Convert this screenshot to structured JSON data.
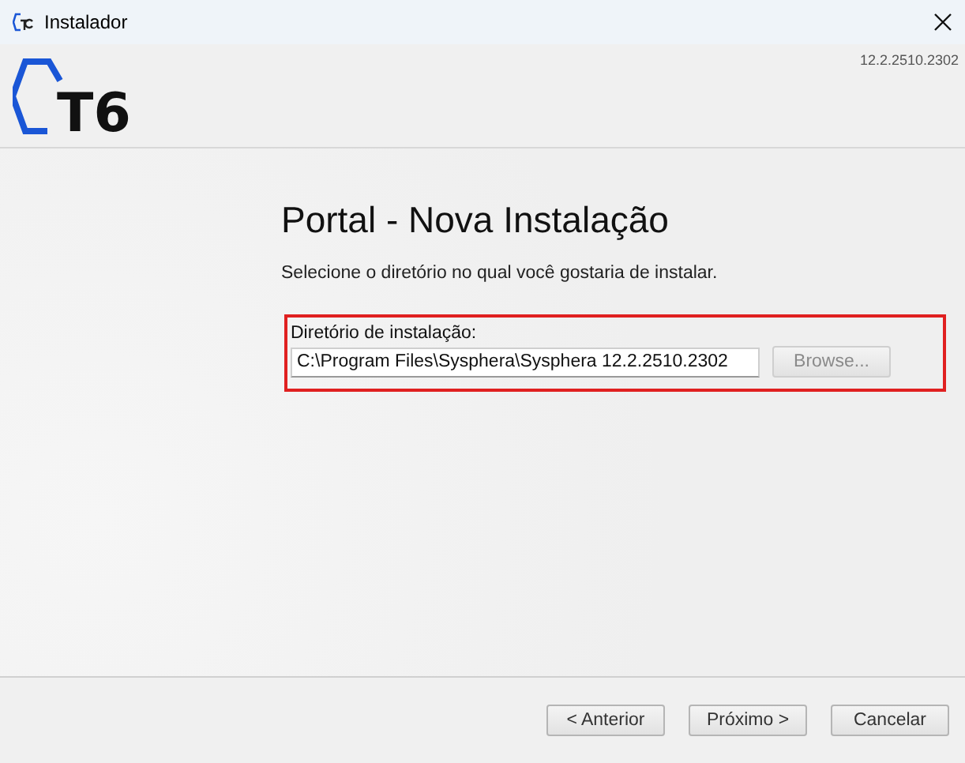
{
  "window": {
    "title": "Instalador"
  },
  "header": {
    "logo": "T6",
    "version": "12.2.2510.2302"
  },
  "content": {
    "title": "Portal - Nova Instalação",
    "subtitle": "Selecione o diretório no qual você gostaria de instalar.",
    "group": {
      "label": "Diretório de instalação:",
      "value": "C:\\Program Files\\Sysphera\\Sysphera 12.2.2510.2302",
      "browse": {
        "label": "Browse...",
        "disabled": true
      }
    }
  },
  "buttons": [
    {
      "label": "< Anterior",
      "disabled": false
    },
    {
      "label": "Próximo >",
      "disabled": false
    },
    {
      "label": "Cancelar",
      "disabled": false
    }
  ]
}
